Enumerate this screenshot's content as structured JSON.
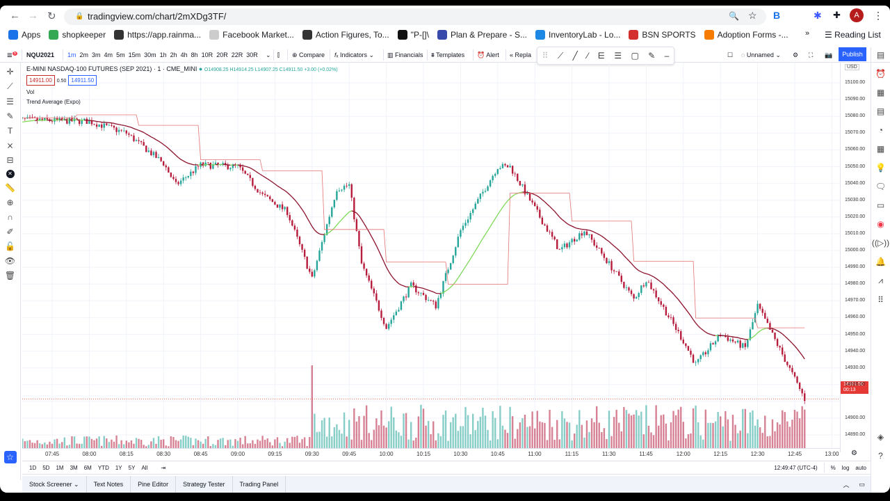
{
  "browser": {
    "url": "tradingview.com/chart/2mXDg3TF/",
    "reading_list": "Reading List",
    "profile_initial": "A",
    "bookmarks": [
      {
        "label": "Apps",
        "color": "#1a73e8"
      },
      {
        "label": "shopkeeper",
        "color": "#34a853"
      },
      {
        "label": "https://app.rainma...",
        "color": "#333333"
      },
      {
        "label": "Facebook Market...",
        "color": "#cccccc"
      },
      {
        "label": "Action Figures, To...",
        "color": "#333333"
      },
      {
        "label": "\"P-[]\\",
        "color": "#111111"
      },
      {
        "label": "Plan & Prepare - S...",
        "color": "#3949ab"
      },
      {
        "label": "InventoryLab - Lo...",
        "color": "#1e88e5"
      },
      {
        "label": "BSN SPORTS",
        "color": "#d32f2f"
      },
      {
        "label": "Adoption Forms -...",
        "color": "#f57c00"
      }
    ]
  },
  "header": {
    "symbol": "NQU2021",
    "notification_count": "5",
    "intervals": [
      "1m",
      "2m",
      "3m",
      "4m",
      "5m",
      "15m",
      "30m",
      "1h",
      "2h",
      "4h",
      "8h",
      "10R",
      "20R",
      "22R",
      "30R"
    ],
    "active_interval": "1m",
    "compare": "Compare",
    "indicators": "Indicators",
    "financials": "Financials",
    "templates": "Templates",
    "alert": "Alert",
    "replay": "Repla",
    "layout_name": "Unnamed",
    "publish": "Publish"
  },
  "legend": {
    "title": "E-MINI NASDAQ-100 FUTURES (SEP 2021) · 1 · CME_MINI",
    "ohlc": "O14908.25 H14914.25 L14907.25 C14911.50 +3.00 (+0.02%)",
    "bid": "14911.00",
    "spread": "0.50",
    "ask": "14911.50",
    "vol": "Vol",
    "indicator": "Trend Average (Expo)"
  },
  "price_axis": {
    "currency": "USD",
    "ticks": [
      "15100.00",
      "15090.00",
      "15080.00",
      "15070.00",
      "15060.00",
      "15050.00",
      "15040.00",
      "15030.00",
      "15020.00",
      "15010.00",
      "15000.00",
      "14990.00",
      "14980.00",
      "14970.00",
      "14960.00",
      "14950.00",
      "14940.00",
      "14930.00",
      "14920.00",
      "14900.00",
      "14890.00"
    ],
    "last_price": "14911.50",
    "countdown": "00:13"
  },
  "time_axis": {
    "ticks": [
      "07:45",
      "08:00",
      "08:15",
      "08:30",
      "08:45",
      "09:00",
      "09:15",
      "09:30",
      "09:45",
      "10:00",
      "10:15",
      "10:30",
      "10:45",
      "11:00",
      "11:15",
      "11:30",
      "11:45",
      "12:00",
      "12:15",
      "12:30",
      "12:45",
      "13:00"
    ]
  },
  "range_bar": {
    "ranges": [
      "1D",
      "5D",
      "1M",
      "3M",
      "6M",
      "YTD",
      "1Y",
      "5Y",
      "All"
    ],
    "clock": "12:49:47 (UTC-4)",
    "percent": "%",
    "log": "log",
    "auto": "auto"
  },
  "bottom_tabs": [
    "Stock Screener",
    "Text Notes",
    "Pine Editor",
    "Strategy Tester",
    "Trading Panel"
  ],
  "colors": {
    "up": "#26a69a",
    "down": "#b71c3c",
    "accent": "#2962ff",
    "last_price": "#e53935"
  },
  "chart_data": {
    "type": "candlestick",
    "ylim": [
      14885,
      15105
    ],
    "xlim": [
      "07:30",
      "13:00"
    ],
    "price_path": [
      [
        "07:30",
        15078
      ],
      [
        "08:00",
        15077
      ],
      [
        "08:15",
        15070
      ],
      [
        "08:30",
        15052
      ],
      [
        "08:35",
        15039
      ],
      [
        "08:45",
        15051
      ],
      [
        "09:00",
        15050
      ],
      [
        "09:10",
        15033
      ],
      [
        "09:20",
        15023
      ],
      [
        "09:30",
        14983
      ],
      [
        "09:40",
        15037
      ],
      [
        "09:45",
        15039
      ],
      [
        "09:50",
        14992
      ],
      [
        "10:00",
        14954
      ],
      [
        "10:10",
        14979
      ],
      [
        "10:20",
        14967
      ],
      [
        "10:30",
        15012
      ],
      [
        "10:45",
        15050
      ],
      [
        "10:50",
        15050
      ],
      [
        "11:00",
        15025
      ],
      [
        "11:10",
        15000
      ],
      [
        "11:20",
        15012
      ],
      [
        "11:30",
        14992
      ],
      [
        "11:40",
        14971
      ],
      [
        "11:45",
        14983
      ],
      [
        "12:00",
        14946
      ],
      [
        "12:05",
        14932
      ],
      [
        "12:15",
        14950
      ],
      [
        "12:25",
        14942
      ],
      [
        "12:30",
        14967
      ],
      [
        "12:40",
        14938
      ],
      [
        "12:49",
        14911.5
      ]
    ]
  }
}
